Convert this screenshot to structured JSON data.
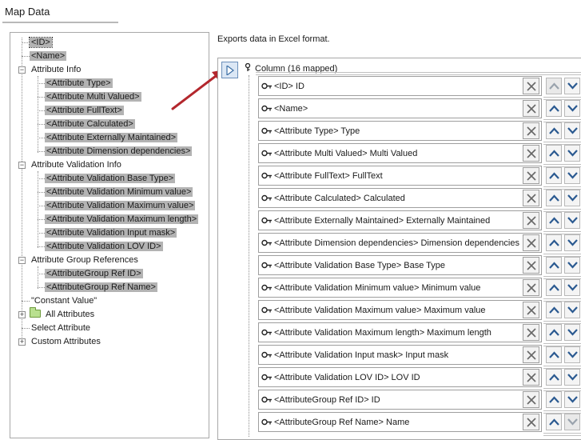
{
  "window": {
    "title": "Map Data"
  },
  "tree": {
    "items": [
      {
        "label": "<ID>"
      },
      {
        "label": "<Name>"
      },
      {
        "label": "Attribute Info"
      },
      {
        "label": "<Attribute Type>"
      },
      {
        "label": "<Attribute Multi Valued>"
      },
      {
        "label": "<Attribute FullText>"
      },
      {
        "label": "<Attribute Calculated>"
      },
      {
        "label": "<Attribute Externally Maintained>"
      },
      {
        "label": "<Attribute Dimension dependencies>"
      },
      {
        "label": "Attribute Validation Info"
      },
      {
        "label": "<Attribute Validation Base Type>"
      },
      {
        "label": "<Attribute Validation Minimum value>"
      },
      {
        "label": "<Attribute Validation Maximum value>"
      },
      {
        "label": "<Attribute Validation Maximum length>"
      },
      {
        "label": "<Attribute Validation Input mask>"
      },
      {
        "label": "<Attribute Validation LOV ID>"
      },
      {
        "label": "Attribute Group References"
      },
      {
        "label": "<AttributeGroup Ref ID>"
      },
      {
        "label": "<AttributeGroup Ref Name>"
      },
      {
        "label": "\"Constant Value\""
      },
      {
        "label": "All Attributes"
      },
      {
        "label": "Select Attribute"
      },
      {
        "label": "Custom Attributes"
      }
    ]
  },
  "main": {
    "description": "Exports data in Excel format.",
    "column_header": "Column (16 mapped)",
    "mappings": [
      {
        "label": "<ID> ID"
      },
      {
        "label": "<Name>"
      },
      {
        "label": "<Attribute Type> Type"
      },
      {
        "label": "<Attribute Multi Valued> Multi Valued"
      },
      {
        "label": "<Attribute FullText> FullText"
      },
      {
        "label": "<Attribute Calculated> Calculated"
      },
      {
        "label": "<Attribute Externally Maintained> Externally Maintained"
      },
      {
        "label": "<Attribute Dimension dependencies> Dimension dependencies"
      },
      {
        "label": "<Attribute Validation Base Type> Base Type"
      },
      {
        "label": "<Attribute Validation Minimum value> Minimum value"
      },
      {
        "label": "<Attribute Validation Maximum value> Maximum value"
      },
      {
        "label": "<Attribute Validation Maximum length> Maximum length"
      },
      {
        "label": "<Attribute Validation Input mask> Input mask"
      },
      {
        "label": "<Attribute Validation LOV ID> LOV ID"
      },
      {
        "label": "<AttributeGroup Ref ID> ID"
      },
      {
        "label": "<AttributeGroup Ref Name> Name"
      }
    ]
  },
  "icons": {
    "add_mapping": "play-arrow-icon",
    "key": "key-icon",
    "remove": "close-icon",
    "move_up": "chevron-up-icon",
    "move_down": "chevron-down-icon",
    "folder": "folder-icon",
    "annotation": "red-arrow"
  },
  "colors": {
    "selection": "#b3b3b3",
    "play_button": "#dbe7f5",
    "annotation_arrow": "#b3272d",
    "chevron_enabled": "#2b5a91",
    "chevron_disabled": "#9aa3ad"
  }
}
